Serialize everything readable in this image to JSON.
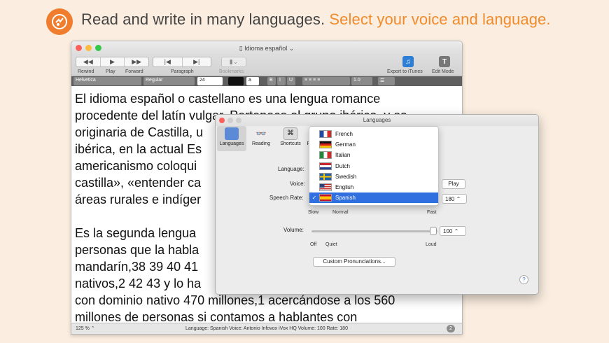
{
  "banner": {
    "text_main": "Read and write in many languages.",
    "text_highlight": "Select your voice and language.",
    "accent": "#f07d2e"
  },
  "window": {
    "title": "Idioma español",
    "toolbar": {
      "rewind": "Rewind",
      "play": "Play",
      "forward": "Forward",
      "paragraph": "Paragraph",
      "bookmarks": "Bookmarks",
      "export": "Export to iTunes",
      "edit_mode": "Edit Mode"
    },
    "format": {
      "font": "Helvetica",
      "style": "Regular",
      "size": "24",
      "spacing": "1.0"
    },
    "document": [
      "El idioma español o castellano es una lengua romance",
      "procedente del latín vulgar. Pertenece al grupo ibérico, y es",
      "originaria de Castilla, u",
      "ibérica, en la actual Es",
      "americanismo coloqui",
      "castilla», «entender ca",
      "áreas rurales e indíger",
      "Es la segunda lengua",
      "personas que la habla",
      "mandarín,38 39 40 41",
      "nativos,2 42 43 y lo ha",
      "con dominio nativo 470 millones,1 acercándose a los 560",
      "millones de personas si contamos a hablantes con"
    ],
    "status": {
      "zoom": "125 %",
      "info": "Language: Spanish   Voice: Antonio Infovox iVox HQ   Volume: 100   Rate: 180",
      "count": "2"
    }
  },
  "prefs": {
    "title": "Languages",
    "tabs": [
      "Languages",
      "Reading",
      "Shortcuts",
      "Re"
    ],
    "language_label": "Language:",
    "voice_label": "Voice:",
    "rate_label": "Speech Rate:",
    "rate_value": "180",
    "rate_ticks": [
      "Slow",
      "Normal",
      "Fast"
    ],
    "volume_label": "Volume:",
    "volume_value": "100",
    "volume_ticks": [
      "Off",
      "Quiet",
      "Loud"
    ],
    "play": "Play",
    "custom": "Custom Pronunciations...",
    "help": "?"
  },
  "dropdown": {
    "options": [
      "French",
      "German",
      "Italian",
      "Dutch",
      "Swedish",
      "English",
      "Spanish"
    ],
    "selected": "Spanish",
    "check": "✓"
  }
}
